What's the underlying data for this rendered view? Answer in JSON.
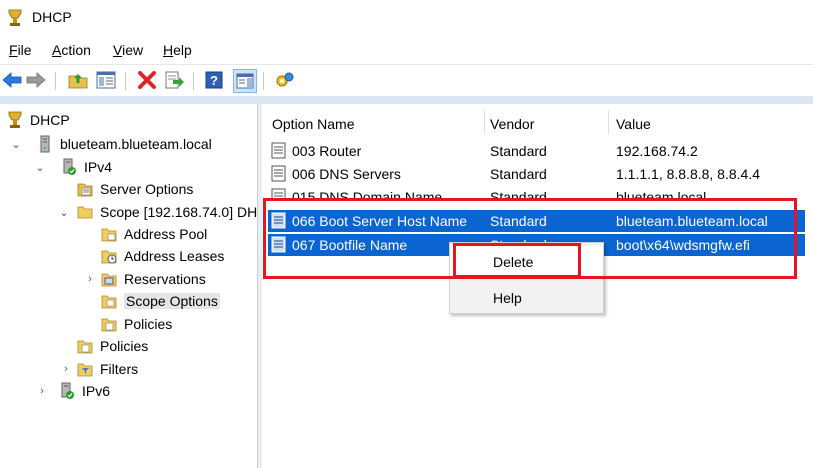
{
  "window": {
    "title": "DHCP"
  },
  "menu": [
    {
      "label": "File",
      "key": "F",
      "rest": "ile"
    },
    {
      "label": "Action",
      "key": "A",
      "rest": "ction"
    },
    {
      "label": "View",
      "key": "V",
      "rest": "iew"
    },
    {
      "label": "Help",
      "key": "H",
      "rest": "elp"
    }
  ],
  "toolbar": {
    "buttons": [
      "back-icon",
      "forward-icon",
      "up-folder-icon",
      "show-hide-tree-icon",
      "delete-icon",
      "export-list-icon",
      "help-icon",
      "properties-icon",
      "action-icon"
    ]
  },
  "tree": {
    "items": [
      {
        "label": "DHCP",
        "icon": "dhcp-icon"
      },
      {
        "label": "blueteam.blueteam.local",
        "icon": "server-icon",
        "chevron": "⌄"
      },
      {
        "label": "IPv4",
        "icon": "ipv4-icon",
        "chevron": "⌄"
      },
      {
        "label": "Server Options",
        "icon": "options-icon"
      },
      {
        "label": "Scope [192.168.74.0] DH",
        "icon": "folder-icon",
        "chevron": "⌄"
      },
      {
        "label": "Address Pool",
        "icon": "folder-icon"
      },
      {
        "label": "Address Leases",
        "icon": "folder-clock-icon"
      },
      {
        "label": "Reservations",
        "icon": "folder-icon",
        "chevron": "›"
      },
      {
        "label": "Scope Options",
        "icon": "folder-icon"
      },
      {
        "label": "Policies",
        "icon": "folder-icon"
      },
      {
        "label": "Policies",
        "icon": "folder-icon"
      },
      {
        "label": "Filters",
        "icon": "filter-icon",
        "chevron": "›"
      },
      {
        "label": "IPv6",
        "icon": "ipv6-icon",
        "chevron": "›"
      }
    ]
  },
  "list": {
    "headers": [
      "Option Name",
      "Vendor",
      "Value"
    ],
    "rows": [
      {
        "name": "003 Router",
        "vendor": "Standard",
        "value": "192.168.74.2"
      },
      {
        "name": "006 DNS Servers",
        "vendor": "Standard",
        "value": "1.1.1.1, 8.8.8.8, 8.8.4.4"
      },
      {
        "name": "015 DNS Domain Name",
        "vendor": "Standard",
        "value": "blueteam.local"
      },
      {
        "name": "066 Boot Server Host Name",
        "vendor": "Standard",
        "value": "blueteam.blueteam.local"
      },
      {
        "name": "067 Bootfile Name",
        "vendor": "Standard",
        "value": "boot\\x64\\wdsmgfw.efi"
      }
    ]
  },
  "context_menu": {
    "items": [
      "Delete",
      "Help"
    ]
  },
  "colors": {
    "selection": "#0a64d2",
    "annotation_red": "#e8141e",
    "menu_bg": "#f2f2f2"
  }
}
